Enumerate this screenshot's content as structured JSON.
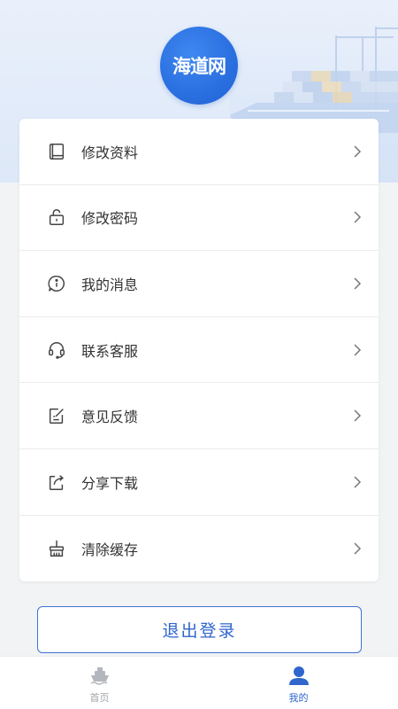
{
  "header": {
    "logo_text": "海道网"
  },
  "menu": {
    "items": [
      {
        "label": "修改资料",
        "icon": "profile-book-icon"
      },
      {
        "label": "修改密码",
        "icon": "lock-icon"
      },
      {
        "label": "我的消息",
        "icon": "info-message-icon"
      },
      {
        "label": "联系客服",
        "icon": "headset-icon"
      },
      {
        "label": "意见反馈",
        "icon": "feedback-edit-icon"
      },
      {
        "label": "分享下载",
        "icon": "share-icon"
      },
      {
        "label": "清除缓存",
        "icon": "broom-icon"
      }
    ]
  },
  "logout": {
    "label": "退出登录"
  },
  "tabbar": {
    "tabs": [
      {
        "label": "首页",
        "icon": "ship-icon",
        "active": false
      },
      {
        "label": "我的",
        "icon": "user-icon",
        "active": true
      }
    ]
  },
  "colors": {
    "accent": "#2f65cc",
    "inactive": "#a0a4ab",
    "background": "#f2f3f5"
  }
}
